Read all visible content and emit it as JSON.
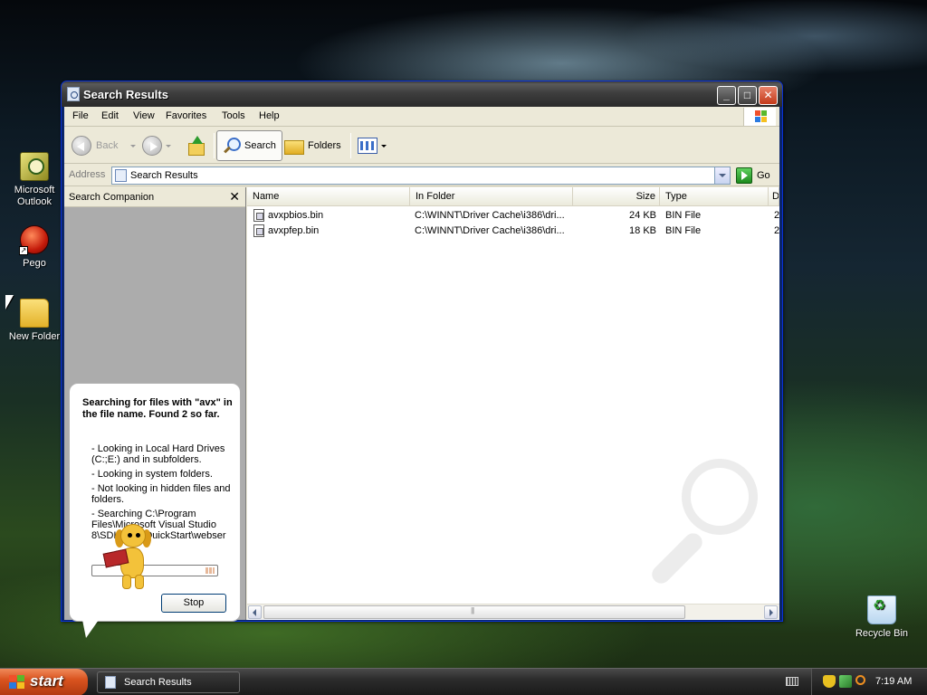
{
  "desktop": {
    "icons": [
      {
        "label": "Microsoft Outlook"
      },
      {
        "label": "Pego"
      },
      {
        "label": "New Folder"
      },
      {
        "label": "Recycle Bin"
      }
    ]
  },
  "window": {
    "title": "Search Results",
    "menu": [
      "File",
      "Edit",
      "View",
      "Favorites",
      "Tools",
      "Help"
    ],
    "toolbar": {
      "back": "Back",
      "search": "Search",
      "folders": "Folders"
    },
    "address": {
      "label": "Address",
      "value": "Search Results",
      "go": "Go"
    },
    "companion": {
      "header": "Search Companion",
      "close_glyph": "✕",
      "status_title": "Searching for files with \"avx\" in the file name. Found 2 so far.",
      "details": [
        "- Looking in Local Hard Drives (C:;E:) and in subfolders.",
        "- Looking in system folders.",
        "- Not looking in hidden files and folders.",
        "- Searching C:\\Program Files\\Microsoft Visual Studio 8\\SDK\\v2.0\\QuickStart\\webser"
      ],
      "stop": "Stop"
    },
    "results": {
      "columns": [
        "Name",
        "In Folder",
        "Size",
        "Type",
        "D"
      ],
      "rows": [
        {
          "name": "avxpbios.bin",
          "folder": "C:\\WINNT\\Driver Cache\\i386\\dri...",
          "size": "24 KB",
          "type": "BIN File",
          "date": "2"
        },
        {
          "name": "avxpfep.bin",
          "folder": "C:\\WINNT\\Driver Cache\\i386\\dri...",
          "size": "18 KB",
          "type": "BIN File",
          "date": "2"
        }
      ]
    }
  },
  "taskbar": {
    "start": "start",
    "task": "Search Results",
    "time": "7:19 AM"
  }
}
